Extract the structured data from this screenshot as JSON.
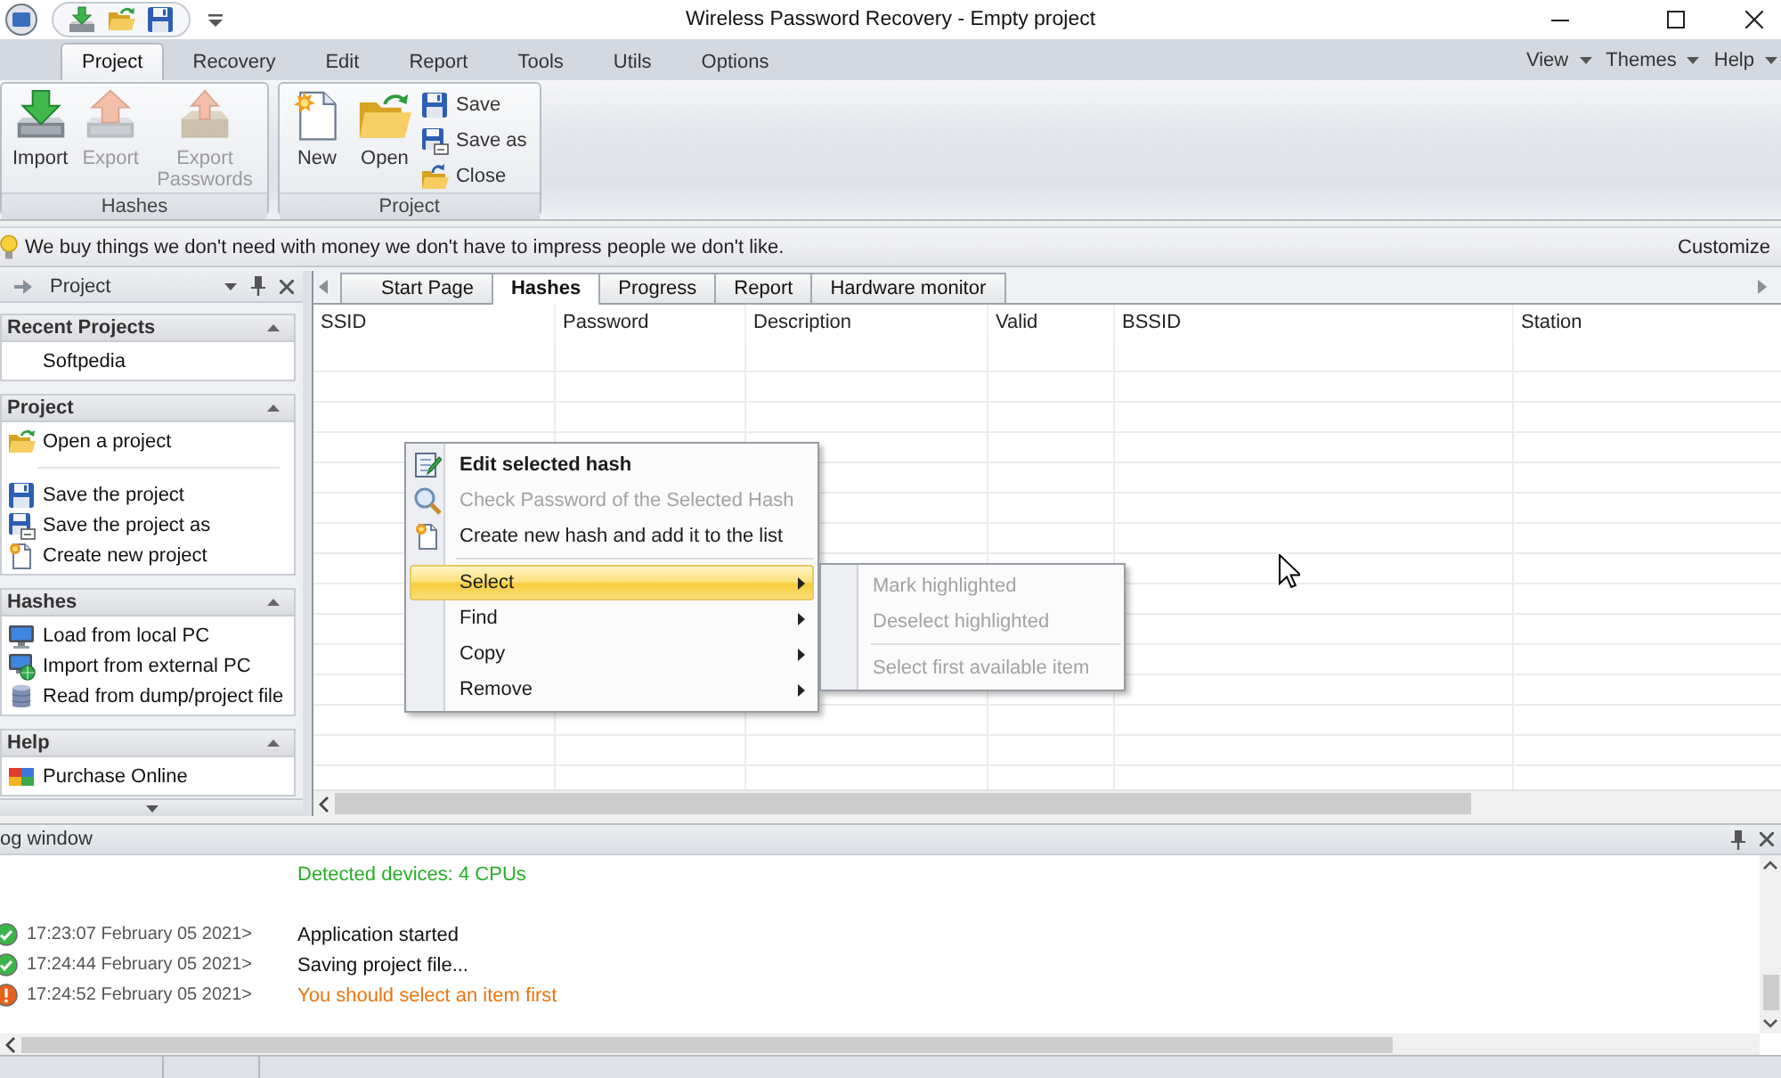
{
  "window": {
    "title": "Wireless Password Recovery - Empty project"
  },
  "ribbon": {
    "tabs": [
      {
        "label": "Project",
        "selected": true
      },
      {
        "label": "Recovery",
        "selected": false
      },
      {
        "label": "Edit",
        "selected": false
      },
      {
        "label": "Report",
        "selected": false
      },
      {
        "label": "Tools",
        "selected": false
      },
      {
        "label": "Utils",
        "selected": false
      },
      {
        "label": "Options",
        "selected": false
      }
    ],
    "menus": [
      {
        "label": "View"
      },
      {
        "label": "Themes"
      },
      {
        "label": "Help"
      }
    ],
    "groups": [
      {
        "title": "Hashes",
        "buttons": [
          {
            "label": "Import",
            "kind": "large",
            "disabled": false
          },
          {
            "label": "Export",
            "kind": "large",
            "disabled": true
          },
          {
            "label": "Export Passwords",
            "kind": "large",
            "disabled": true
          }
        ]
      },
      {
        "title": "Project",
        "buttons": [
          {
            "label": "New",
            "kind": "large",
            "disabled": false
          },
          {
            "label": "Open",
            "kind": "large",
            "disabled": false
          },
          {
            "label": "Save",
            "kind": "small",
            "disabled": false
          },
          {
            "label": "Save as",
            "kind": "small",
            "disabled": false
          },
          {
            "label": "Close",
            "kind": "small",
            "disabled": false
          }
        ]
      }
    ]
  },
  "tip_bar": {
    "text": "We buy things we don't need with money we don't have to impress people we don't like.",
    "action": "Customize"
  },
  "project_panel": {
    "title": "Project",
    "sections": [
      {
        "title": "Recent Projects",
        "expanded": true,
        "groups": [
          [
            {
              "label": "Softpedia"
            }
          ]
        ]
      },
      {
        "title": "Project",
        "expanded": true,
        "groups": [
          [
            {
              "label": "Open a project"
            }
          ],
          [
            {
              "label": "Save the project"
            },
            {
              "label": "Save the project as"
            },
            {
              "label": "Create new project"
            }
          ]
        ]
      },
      {
        "title": "Hashes",
        "expanded": true,
        "groups": [
          [
            {
              "label": "Load from local PC"
            },
            {
              "label": "Import from external PC"
            },
            {
              "label": "Read from dump/project file"
            }
          ]
        ]
      },
      {
        "title": "Help",
        "expanded": true,
        "groups": [
          [
            {
              "label": "Purchase Online"
            }
          ]
        ]
      }
    ]
  },
  "document_tabs": [
    {
      "label": "Start Page",
      "selected": false
    },
    {
      "label": "Hashes",
      "selected": true
    },
    {
      "label": "Progress",
      "selected": false
    },
    {
      "label": "Report",
      "selected": false
    },
    {
      "label": "Hardware monitor",
      "selected": false
    }
  ],
  "table": {
    "columns": [
      "SSID",
      "Password",
      "Description",
      "Valid",
      "BSSID",
      "Station"
    ]
  },
  "context_menu": {
    "sections": [
      [
        {
          "label": "Edit selected hash",
          "default": true,
          "disabled": false,
          "selected": false,
          "has_submenu": false
        },
        {
          "label": "Check Password of the Selected Hash",
          "default": false,
          "disabled": true,
          "selected": false,
          "has_submenu": false
        },
        {
          "label": "Create new hash and add it to the list",
          "default": false,
          "disabled": false,
          "selected": false,
          "has_submenu": false
        }
      ],
      [
        {
          "label": "Select",
          "default": false,
          "disabled": false,
          "selected": true,
          "has_submenu": true
        },
        {
          "label": "Find",
          "default": false,
          "disabled": false,
          "selected": false,
          "has_submenu": true
        },
        {
          "label": "Copy",
          "default": false,
          "disabled": false,
          "selected": false,
          "has_submenu": true
        },
        {
          "label": "Remove",
          "default": false,
          "disabled": false,
          "selected": false,
          "has_submenu": true
        }
      ]
    ]
  },
  "submenu": {
    "sections": [
      [
        {
          "label": "Mark highlighted",
          "disabled": true,
          "selected": false
        },
        {
          "label": "Deselect highlighted",
          "disabled": true,
          "selected": false
        }
      ],
      [
        {
          "label": "Select first available item",
          "disabled": true,
          "selected": false
        }
      ]
    ]
  },
  "log_window": {
    "title": "og window",
    "lines": [
      {
        "kind": "info",
        "message": "Detected devices: 4 CPUs"
      },
      {
        "kind": "ok",
        "time": "17:23:07 February 05 2021>",
        "message": "Application started"
      },
      {
        "kind": "ok",
        "time": "17:24:44 February 05 2021>",
        "message": "Saving project file..."
      },
      {
        "kind": "warning",
        "time": "17:24:52 February 05 2021>",
        "message": "You should select an item first"
      }
    ]
  }
}
